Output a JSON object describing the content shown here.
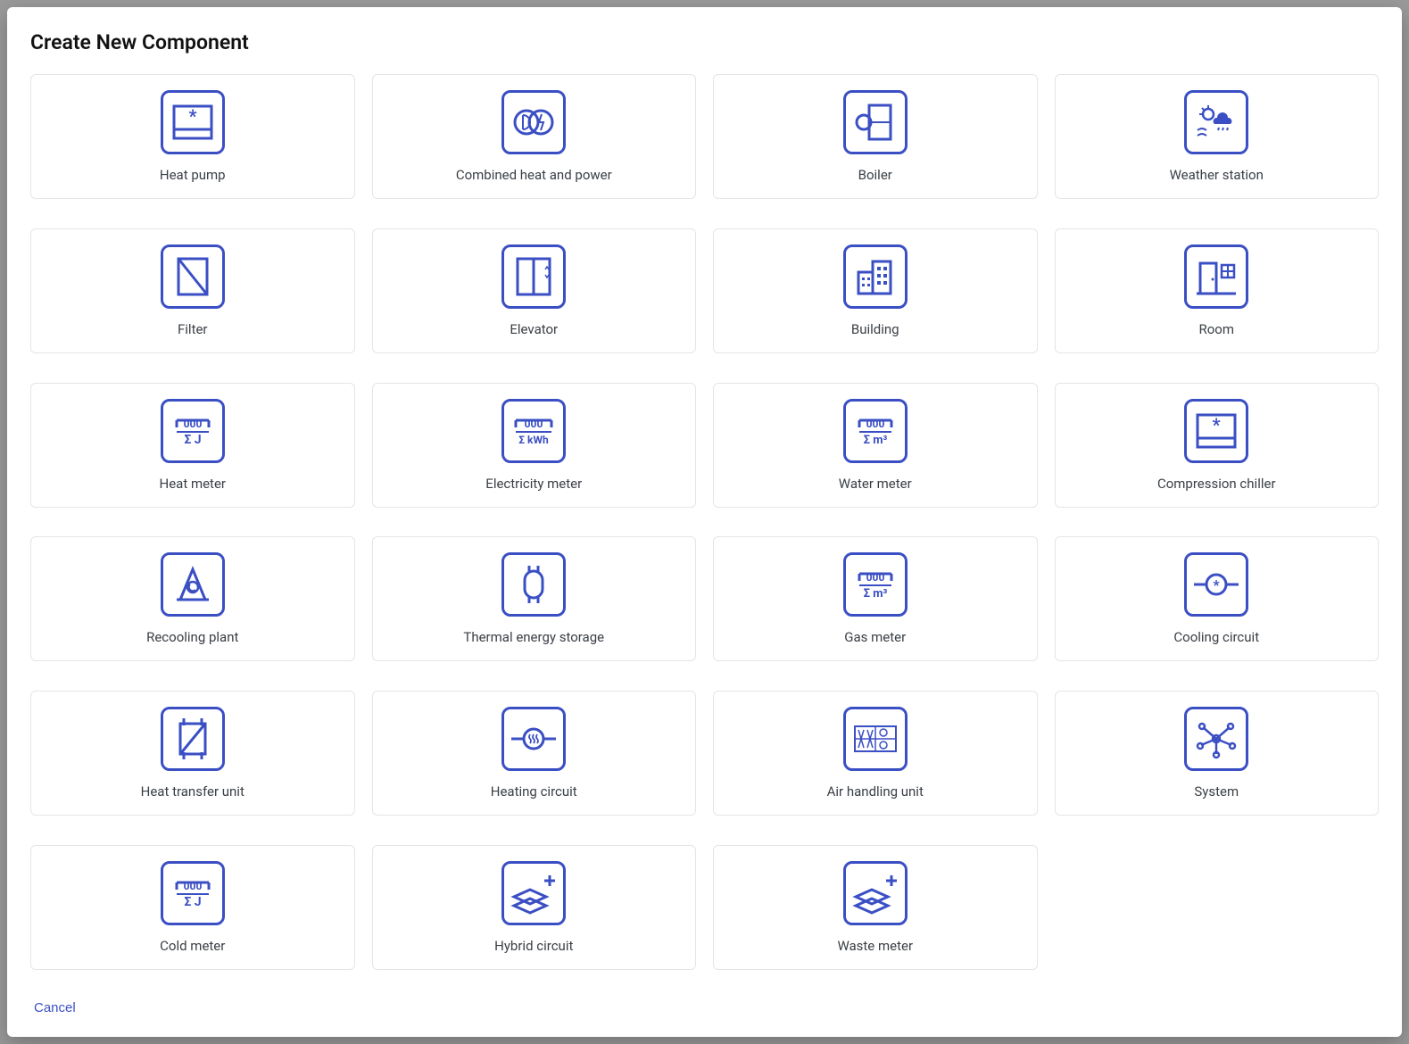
{
  "modal": {
    "title": "Create New Component",
    "cancel_label": "Cancel",
    "components": [
      {
        "id": "heat-pump",
        "label": "Heat pump"
      },
      {
        "id": "combined-heat-and-power",
        "label": "Combined heat and power"
      },
      {
        "id": "boiler",
        "label": "Boiler"
      },
      {
        "id": "weather-station",
        "label": "Weather station"
      },
      {
        "id": "filter",
        "label": "Filter"
      },
      {
        "id": "elevator",
        "label": "Elevator"
      },
      {
        "id": "building",
        "label": "Building"
      },
      {
        "id": "room",
        "label": "Room"
      },
      {
        "id": "heat-meter",
        "label": "Heat meter"
      },
      {
        "id": "electricity-meter",
        "label": "Electricity meter"
      },
      {
        "id": "water-meter",
        "label": "Water meter"
      },
      {
        "id": "compression-chiller",
        "label": "Compression chiller"
      },
      {
        "id": "recooling-plant",
        "label": "Recooling plant"
      },
      {
        "id": "thermal-energy-storage",
        "label": "Thermal energy storage"
      },
      {
        "id": "gas-meter",
        "label": "Gas meter"
      },
      {
        "id": "cooling-circuit",
        "label": "Cooling circuit"
      },
      {
        "id": "heat-transfer-unit",
        "label": "Heat transfer unit"
      },
      {
        "id": "heating-circuit",
        "label": "Heating circuit"
      },
      {
        "id": "air-handling-unit",
        "label": "Air handling unit"
      },
      {
        "id": "system",
        "label": "System"
      },
      {
        "id": "cold-meter",
        "label": "Cold meter"
      },
      {
        "id": "hybrid-circuit",
        "label": "Hybrid circuit"
      },
      {
        "id": "waste-meter",
        "label": "Waste meter"
      }
    ]
  },
  "colors": {
    "accent": "#3b4fc4",
    "border": "#e3e5e8",
    "text": "#3a3f45"
  }
}
